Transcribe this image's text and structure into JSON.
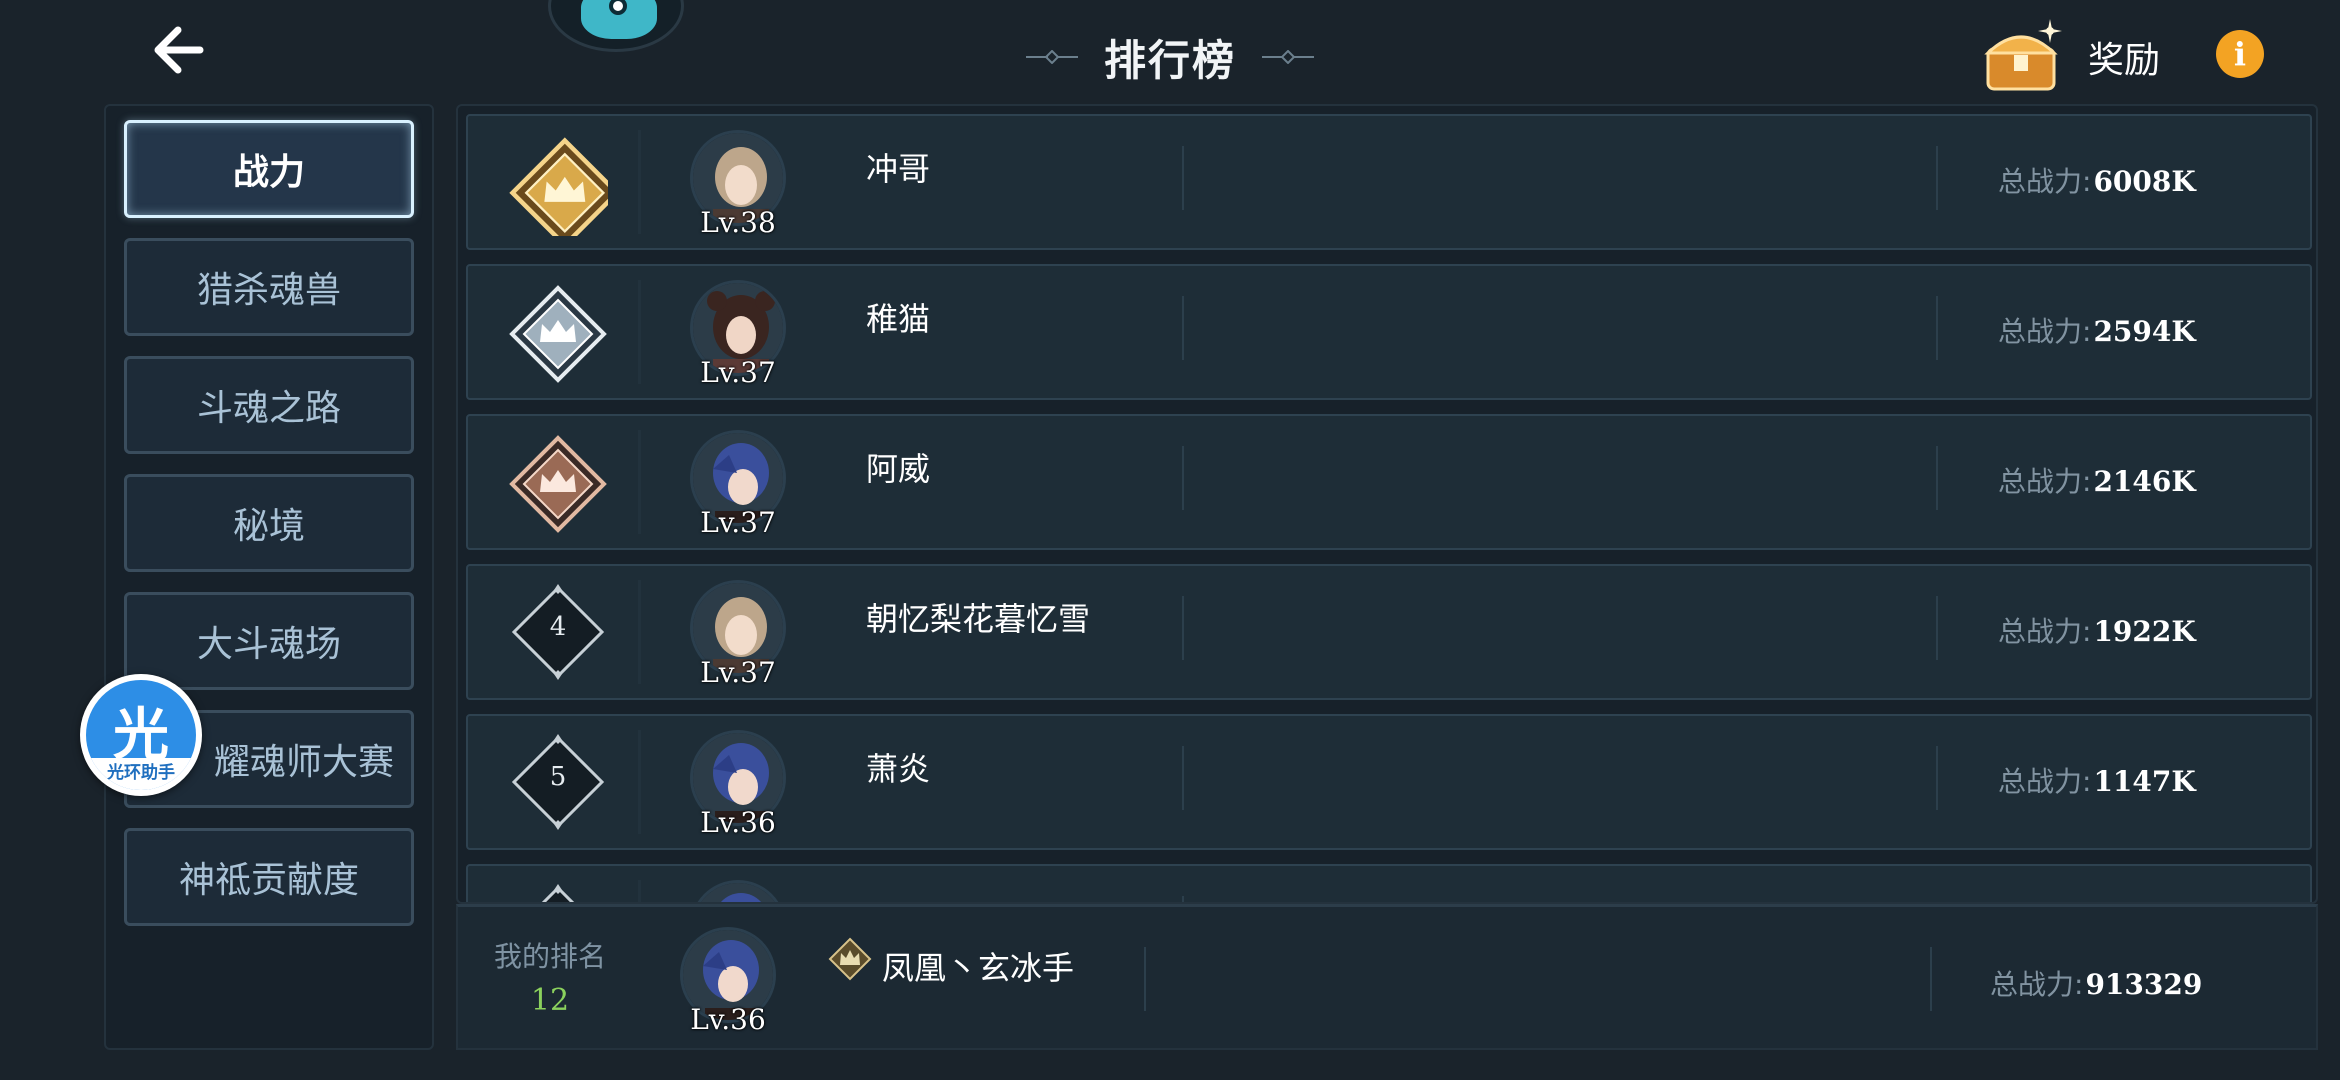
{
  "header": {
    "back_icon": "arrow-left-icon",
    "title": "排行榜",
    "reward_label": "奖励",
    "reward_icon": "treasure-chest-icon",
    "info_icon": "info-icon",
    "info_glyph": "i"
  },
  "sidebar": {
    "items": [
      {
        "label": "战力",
        "active": true
      },
      {
        "label": "猎杀魂兽",
        "active": false
      },
      {
        "label": "斗魂之路",
        "active": false
      },
      {
        "label": "秘境",
        "active": false
      },
      {
        "label": "大斗魂场",
        "active": false
      },
      {
        "label": "耀魂师大赛",
        "active": false
      },
      {
        "label": "神祗贡献度",
        "active": false
      }
    ]
  },
  "helper_badge": {
    "glyph": "光",
    "label": "光环助手"
  },
  "ranking": {
    "power_label": "总战力:",
    "rows": [
      {
        "rank": "1",
        "rank_icon": "gold-crown-badge-icon",
        "name": "冲哥",
        "level": "Lv.38",
        "power": "6008K"
      },
      {
        "rank": "2",
        "rank_icon": "silver-crown-badge-icon",
        "name": "稚猫",
        "level": "Lv.37",
        "power": "2594K"
      },
      {
        "rank": "3",
        "rank_icon": "bronze-crown-badge-icon",
        "name": "阿威",
        "level": "Lv.37",
        "power": "2146K"
      },
      {
        "rank": "4",
        "rank_icon": "diamond-rank-icon",
        "name": "朝忆梨花暮忆雪",
        "level": "Lv.37",
        "power": "1922K"
      },
      {
        "rank": "5",
        "rank_icon": "diamond-rank-icon",
        "name": "萧炎",
        "level": "Lv.36",
        "power": "1147K"
      },
      {
        "rank": "",
        "rank_icon": "diamond-rank-icon",
        "name": "",
        "level": "",
        "power": ""
      }
    ]
  },
  "my_rank": {
    "label": "我的排名",
    "rank": "12",
    "title_icon": "rank-emblem-icon",
    "name": "凤凰丶玄冰手",
    "level": "Lv.36",
    "power_label": "总战力:",
    "power": "913329"
  },
  "colors": {
    "background": "#1a232b",
    "active_border": "#d9f1ff",
    "gold": "#d9a94a",
    "silver": "#d7dde2",
    "bronze": "#c08a6c",
    "my_rank_value": "#8bd15d",
    "info": "#f3a323"
  }
}
